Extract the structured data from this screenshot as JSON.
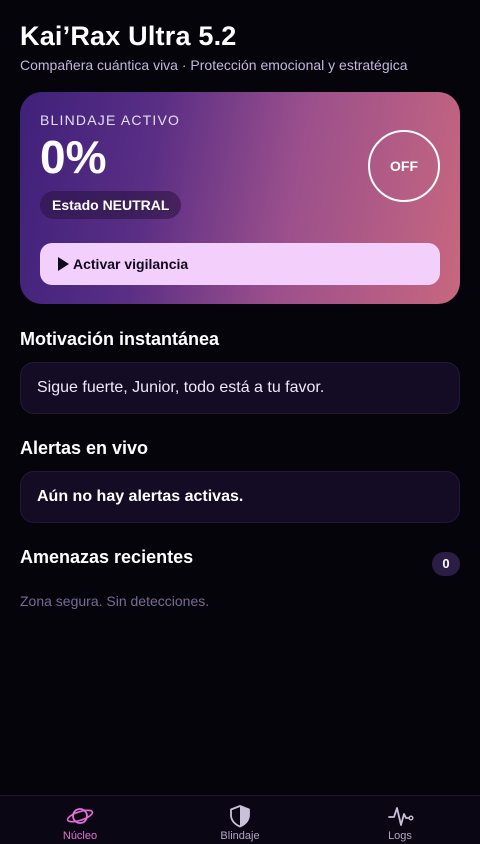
{
  "header": {
    "title": "Kai’Rax Ultra 5.2",
    "subtitle": "Compañera cuántica viva · Protección emocional y estratégica"
  },
  "shield": {
    "label": "BLINDAJE ACTIVO",
    "percent": "0%",
    "state": "Estado NEUTRAL",
    "toggle": "OFF",
    "activate_button": "Activar vigilancia"
  },
  "motivation": {
    "title": "Motivación instantánea",
    "message": "Sigue fuerte, Junior, todo está a tu favor."
  },
  "alerts": {
    "title": "Alertas en vivo",
    "message": "Aún no hay alertas activas."
  },
  "threats": {
    "title": "Amenazas recientes",
    "count": "0",
    "empty_text": "Zona segura. Sin detecciones."
  },
  "tabbar": {
    "tabs": [
      {
        "label": "Núcleo",
        "icon": "planet-icon",
        "active": true
      },
      {
        "label": "Blindaje",
        "icon": "shield-icon",
        "active": false
      },
      {
        "label": "Logs",
        "icon": "pulse-icon",
        "active": false
      }
    ]
  },
  "colors": {
    "background": "#05040a",
    "accent": "#e470d7",
    "card_gradient_start": "#3f217a",
    "card_gradient_end": "#c8677f",
    "button_bg": "#f3d0fb"
  }
}
